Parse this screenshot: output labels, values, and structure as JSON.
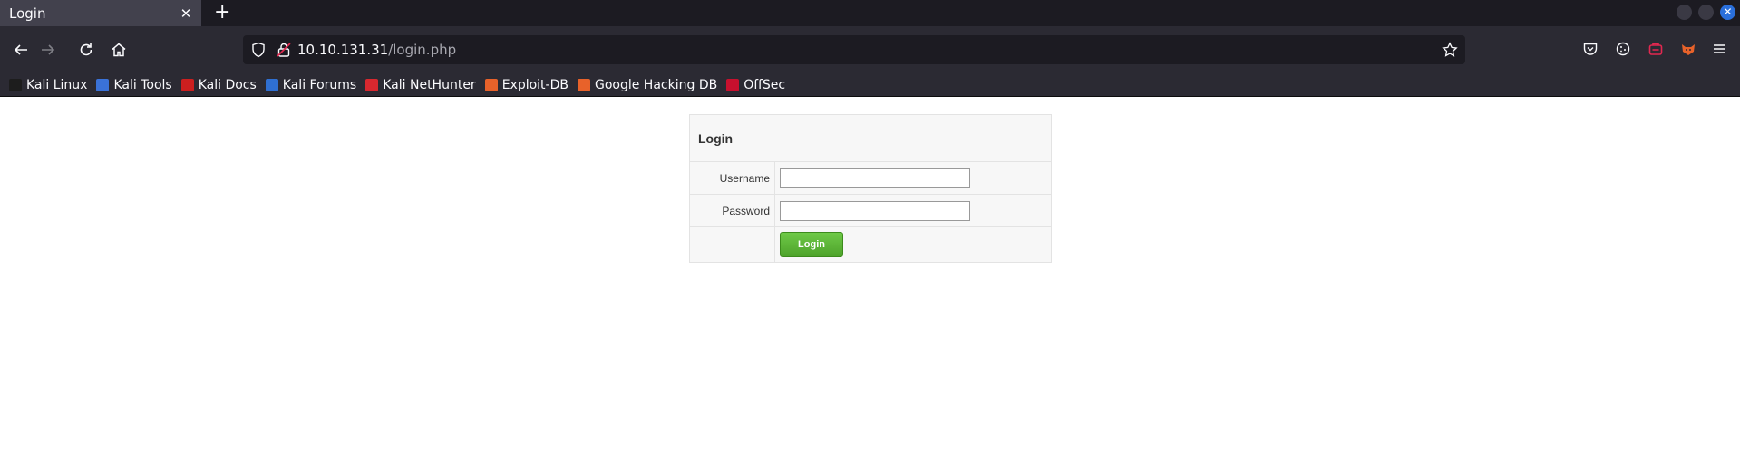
{
  "browser": {
    "tab": {
      "title": "Login",
      "close_glyph": "✕"
    },
    "new_tab_glyph": "+",
    "url": {
      "host": "10.10.131.31",
      "path": "/login.php"
    },
    "nav_icons": [
      "back-arrow-icon",
      "forward-arrow-icon",
      "reload-icon",
      "home-icon"
    ],
    "right_icons": [
      "pocket-icon",
      "cookie-icon",
      "extension-icon",
      "foxyproxy-icon",
      "menu-icon"
    ]
  },
  "bookmarks": [
    {
      "label": "Kali Linux",
      "color": "#1d1d1d"
    },
    {
      "label": "Kali Tools",
      "color": "#3a72d8"
    },
    {
      "label": "Kali Docs",
      "color": "#cc1f1f"
    },
    {
      "label": "Kali Forums",
      "color": "#2f6fd1"
    },
    {
      "label": "Kali NetHunter",
      "color": "#d8282f"
    },
    {
      "label": "Exploit-DB",
      "color": "#e8622a"
    },
    {
      "label": "Google Hacking DB",
      "color": "#e8622a"
    },
    {
      "label": "OffSec",
      "color": "#c8102e"
    }
  ],
  "login_form": {
    "heading": "Login",
    "username_label": "Username",
    "username_value": "",
    "password_label": "Password",
    "password_value": "",
    "submit_label": "Login"
  },
  "colors": {
    "tab_active": "#42414d",
    "toolbar": "#2b2a33",
    "urlbar": "#1c1b22",
    "login_button": "#5bb535"
  }
}
